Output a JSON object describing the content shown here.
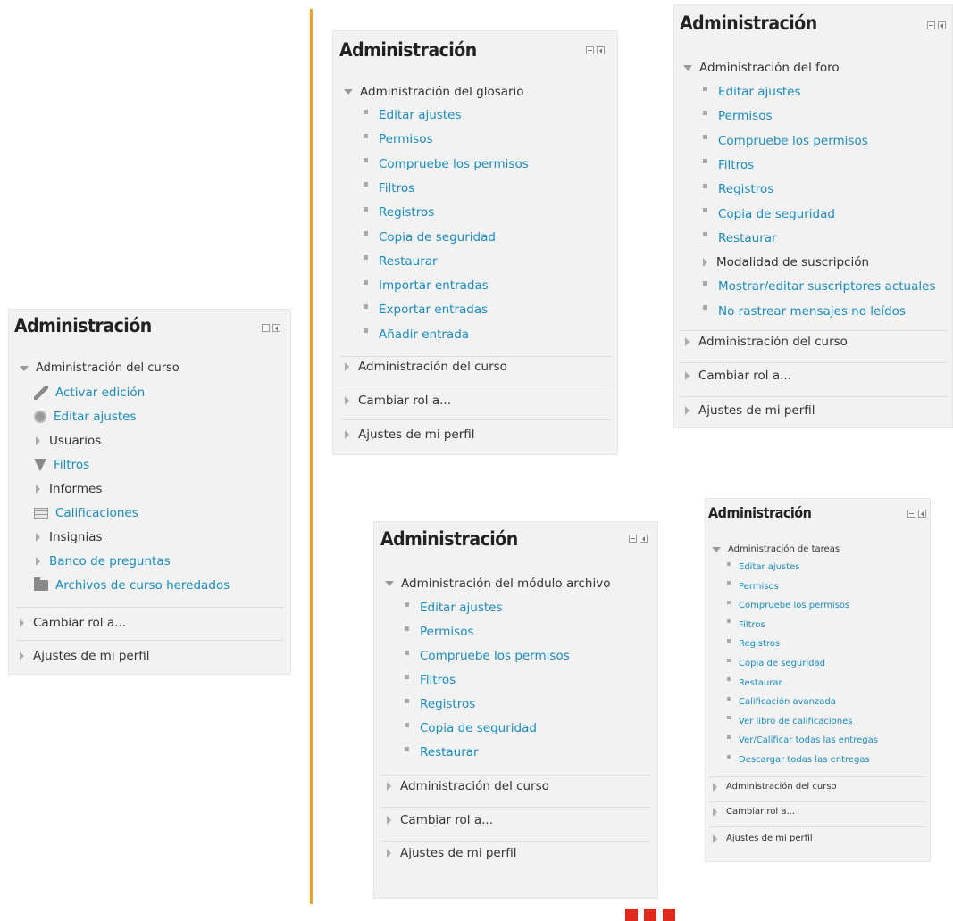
{
  "panel_title": "Administración",
  "block1": {
    "section": "Administración del curso",
    "items": [
      "Activar edición",
      "Editar ajustes",
      "Usuarios",
      "Filtros",
      "Informes",
      "Calificaciones",
      "Insignias",
      "Banco de preguntas",
      "Archivos de curso heredados"
    ],
    "footer": [
      "Cambiar rol a...",
      "Ajustes de mi perfil"
    ]
  },
  "block2": {
    "section": "Administración del glosario",
    "items": [
      "Editar ajustes",
      "Permisos",
      "Compruebe los permisos",
      "Filtros",
      "Registros",
      "Copia de seguridad",
      "Restaurar",
      "Importar entradas",
      "Exportar entradas",
      "Añadir entrada"
    ],
    "footer": [
      "Administración del curso",
      "Cambiar rol a...",
      "Ajustes de mi perfil"
    ]
  },
  "block3": {
    "section": "Administración del foro",
    "items": [
      "Editar ajustes",
      "Permisos",
      "Compruebe los permisos",
      "Filtros",
      "Registros",
      "Copia de seguridad",
      "Restaurar",
      "Modalidad de suscripción",
      "Mostrar/editar suscriptores actuales",
      "No rastrear mensajes no leídos"
    ],
    "footer": [
      "Administración del curso",
      "Cambiar rol a...",
      "Ajustes de mi perfil"
    ]
  },
  "block4": {
    "section": "Administración del módulo archivo",
    "items": [
      "Editar ajustes",
      "Permisos",
      "Compruebe los permisos",
      "Filtros",
      "Registros",
      "Copia de seguridad",
      "Restaurar"
    ],
    "footer": [
      "Administración del curso",
      "Cambiar rol a...",
      "Ajustes de mi perfil"
    ]
  },
  "block5": {
    "section": "Administración de tareas",
    "items": [
      "Editar ajustes",
      "Permisos",
      "Compruebe los permisos",
      "Filtros",
      "Registros",
      "Copia de seguridad",
      "Restaurar",
      "Calificación avanzada",
      "Ver libro de calificaciones",
      "Ver/Calificar todas las entregas",
      "Descargar todas las entregas"
    ],
    "footer": [
      "Administración del curso",
      "Cambiar rol a...",
      "Ajustes de mi perfil"
    ]
  },
  "colors": {
    "link": "#1a8bbf",
    "divider": "#f0a020",
    "logo": "#e02a1e"
  }
}
